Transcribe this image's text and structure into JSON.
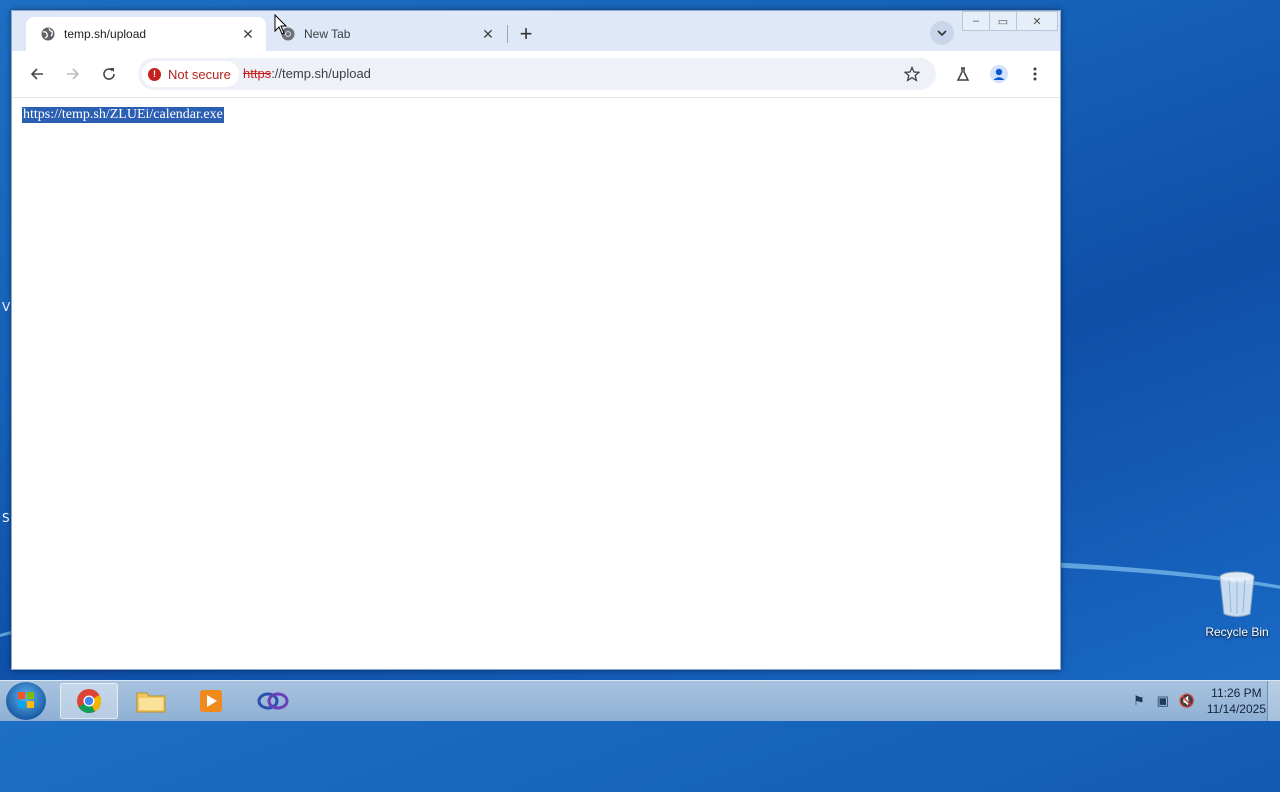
{
  "browser": {
    "tabs": [
      {
        "title": "temp.sh/upload",
        "icon": "globe-icon",
        "active": true
      },
      {
        "title": "New Tab",
        "icon": "chrome-icon",
        "active": false
      }
    ],
    "new_tab_symbol": "+",
    "window_controls": {
      "minimize": "–",
      "maximize": "▭",
      "close": "✕"
    },
    "toolbar": {
      "security_label": "Not secure",
      "url_scheme": "https",
      "url_rest": "://temp.sh/upload"
    },
    "content": {
      "selected_text": "https://temp.sh/ZLUEi/calendar.exe"
    }
  },
  "desktop": {
    "recycle_bin_label": "Recycle Bin",
    "edge_letters": [
      "V",
      "S"
    ]
  },
  "taskbar": {
    "items": [
      "start-button",
      "chrome-icon",
      "file-explorer-icon",
      "media-player-icon",
      "app-icon"
    ],
    "clock_time": "11:26 PM",
    "clock_date": "11/14/2025"
  }
}
